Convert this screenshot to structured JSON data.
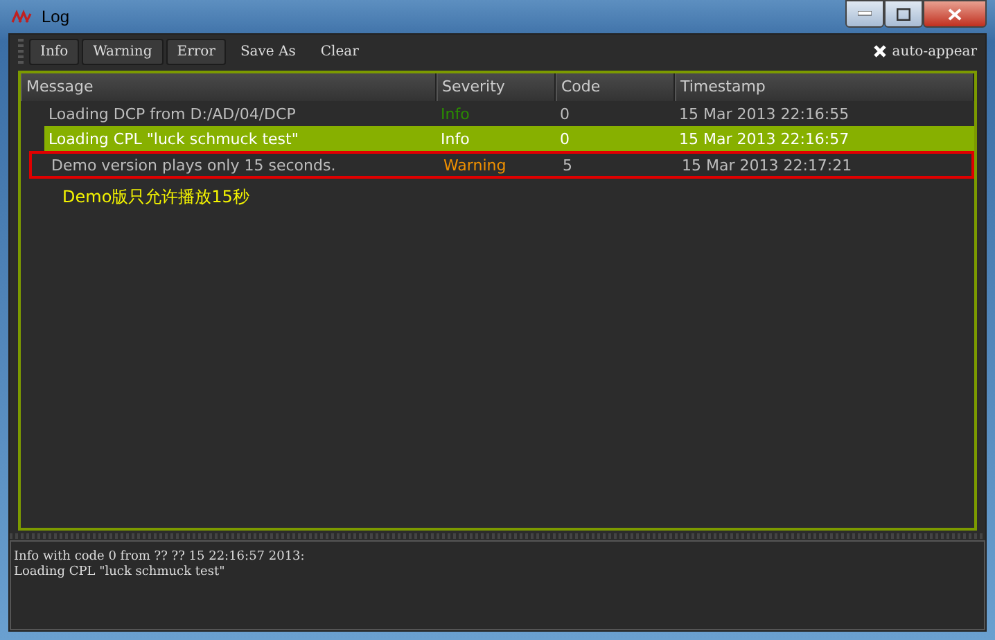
{
  "window": {
    "title": "Log"
  },
  "toolbar": {
    "filters": [
      {
        "label": "Info"
      },
      {
        "label": "Warning"
      },
      {
        "label": "Error"
      }
    ],
    "actions": [
      "Save As",
      "Clear"
    ],
    "auto_appear": {
      "label": "auto-appear",
      "checked": true
    }
  },
  "table": {
    "columns": [
      "Message",
      "Severity",
      "Code",
      "Timestamp"
    ],
    "rows": [
      {
        "message": "Loading DCP from D:/AD/04/DCP",
        "severity": "Info",
        "kind": "info",
        "code": "0",
        "timestamp": "15 Mar 2013 22:16:55",
        "selected": false,
        "highlighted": false
      },
      {
        "message": "Loading CPL \"luck schmuck test\"",
        "severity": "Info",
        "kind": "info",
        "code": "0",
        "timestamp": "15 Mar 2013 22:16:57",
        "selected": true,
        "highlighted": false
      },
      {
        "message": "Demo version plays only 15 seconds.",
        "severity": "Warning",
        "kind": "warning",
        "code": "5",
        "timestamp": "15 Mar 2013 22:17:21",
        "selected": false,
        "highlighted": true
      }
    ],
    "annotation": "Demo版只允许播放15秒"
  },
  "details": [
    "Info with code 0 from ?? ?? 15 22:16:57 2013:",
    "Loading CPL \"luck schmuck test\""
  ]
}
